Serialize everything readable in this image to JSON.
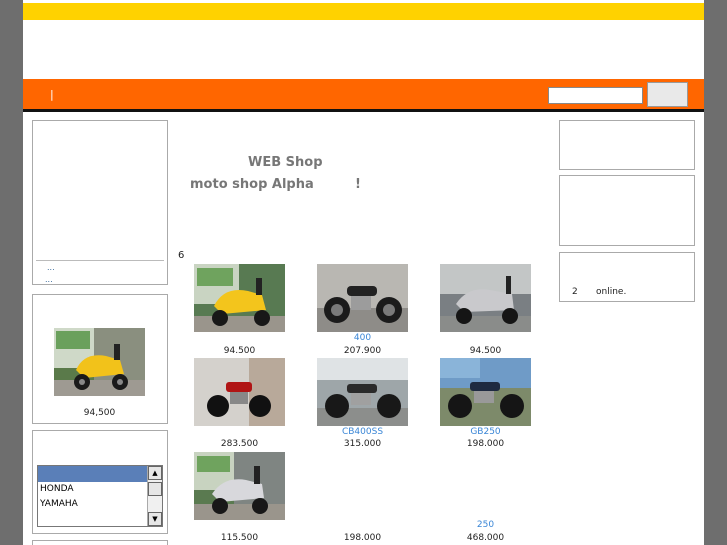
{
  "header": {
    "nav_divider": "|"
  },
  "search": {
    "placeholder": "",
    "value": "",
    "button_label": ""
  },
  "welcome": {
    "line1": "WEB Shop",
    "line2": "moto shop Alpha",
    "line3": "!"
  },
  "item_count": "6",
  "sidebar_left": {
    "more_links": [
      "...",
      "..."
    ],
    "featured_price": "94,500",
    "maker_list": {
      "options": [
        "",
        "HONDA",
        "YAMAHA"
      ],
      "selected_index": 0
    }
  },
  "sidebar_right": {
    "online_count": "2",
    "online_label": "online."
  },
  "products": [
    {
      "price": "94.500",
      "label": ""
    },
    {
      "price": "207.900",
      "label": "400"
    },
    {
      "price": "94.500",
      "label": ""
    },
    {
      "price": "283.500",
      "label": ""
    },
    {
      "price": "315.000",
      "label": "CB400SS"
    },
    {
      "price": "198.000",
      "label": "GB250"
    },
    {
      "price": "115.500",
      "label": ""
    },
    {
      "price": "198.000",
      "label": ""
    },
    {
      "price": "468.000",
      "label": "250"
    }
  ],
  "colors": {
    "header_yellow": "#ffd200",
    "nav_orange": "#ff6600",
    "link_blue": "#3a86d6"
  }
}
